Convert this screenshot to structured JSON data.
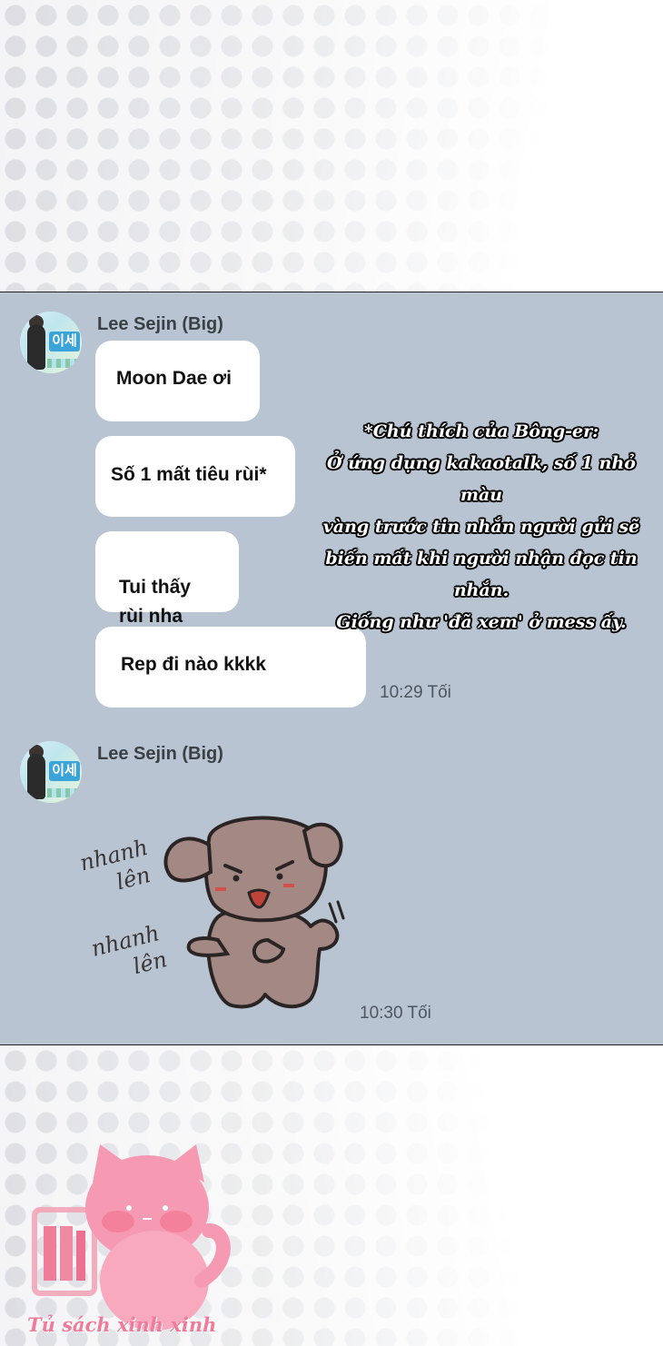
{
  "messages": [
    {
      "sender": "Lee Sejin (Big)",
      "avatar_sign": "이세",
      "bubbles": [
        "Moon Dae ơi",
        "Số 1 mất tiêu rùi*",
        "Tui thấy\nrùi nha",
        "Rep đi nào kkkk"
      ],
      "time": "10:29 Tối"
    },
    {
      "sender": "Lee Sejin (Big)",
      "avatar_sign": "이세",
      "sticker": {
        "icon": "puppy-sticker",
        "text_line_1": "nhanh\nlên",
        "text_line_2": "nhanh\nlên"
      },
      "time": "10:30 Tối"
    }
  ],
  "translator_note": {
    "lines": [
      "*Chú thích của Bông-er:",
      "Ở ứng dụng kakaotalk, số 1 nhỏ màu",
      "vàng trước tin nhắn người gửi sẽ",
      "biến mất khi người nhận đọc tin nhắn.",
      "Giống như 'đã xem' ở mess ấy."
    ]
  },
  "watermark": {
    "text": "Tủ sách xinh xinh",
    "icon": "pink-cat-books-logo"
  },
  "colors": {
    "chat_background": "#b8c4d1",
    "bubble": "#ffffff",
    "watermark_pink": "#f07a9a"
  }
}
